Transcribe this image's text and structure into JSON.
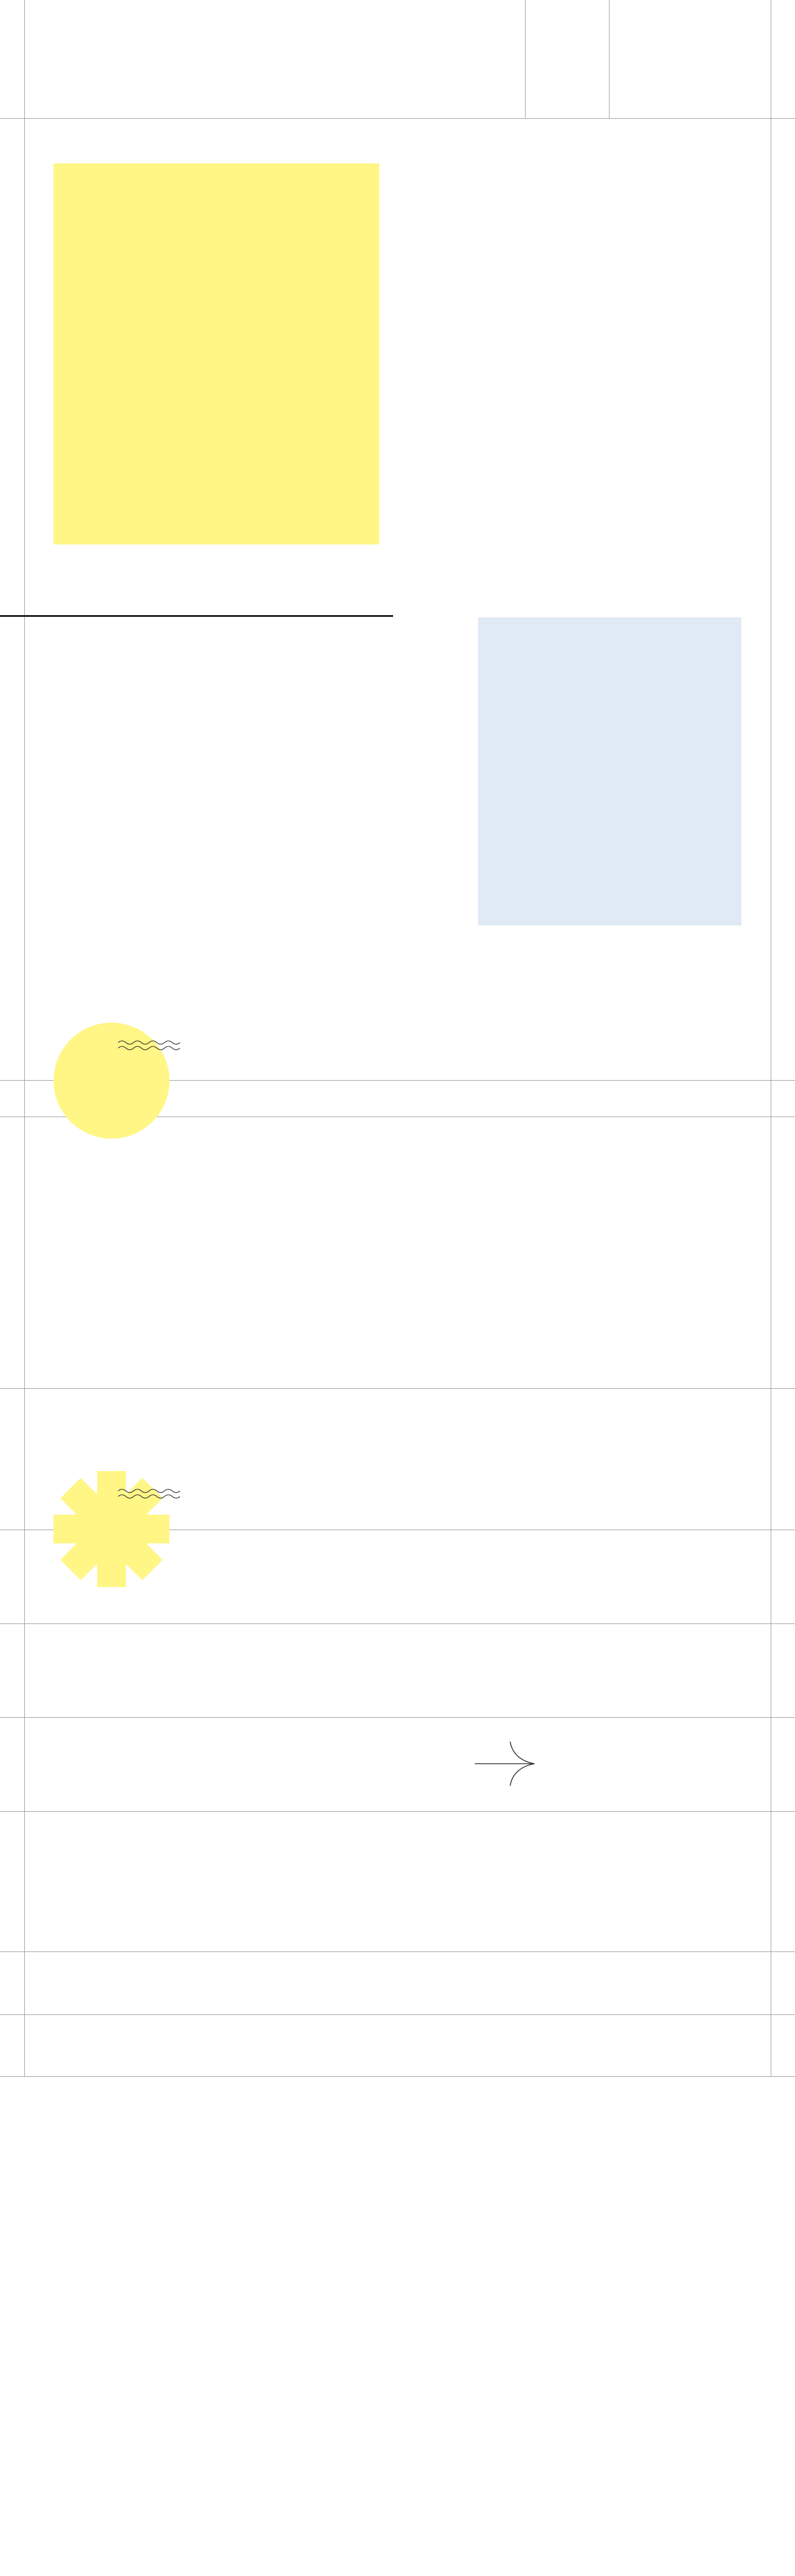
{
  "page": {
    "background_color": "#ffffff"
  },
  "colors": {
    "grid_line": "#9a9a9a",
    "accent_yellow": "#fff685",
    "accent_blue": "#e0eaf4",
    "rule_dark": "#111111",
    "icon_stroke": "#333333"
  },
  "sections": [
    {
      "name": "header-band",
      "content": ""
    },
    {
      "name": "hero-section",
      "content": ""
    },
    {
      "name": "feature-section",
      "content": ""
    },
    {
      "name": "circle-section",
      "content": ""
    },
    {
      "name": "starburst-section",
      "content": ""
    },
    {
      "name": "list-section",
      "content": ""
    }
  ],
  "icons": {
    "circle_decoration": "yellow-circle-shape",
    "starburst_decoration": "yellow-starburst-shape",
    "squiggle_top": "wavy-lines-icon",
    "squiggle_bottom": "wavy-lines-icon",
    "arrow": "arrow-right-icon"
  }
}
